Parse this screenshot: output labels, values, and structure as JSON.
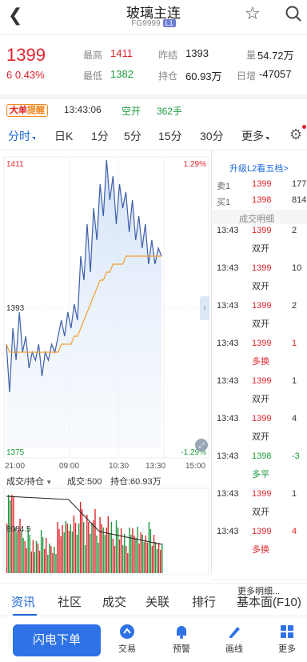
{
  "header": {
    "title": "玻璃主连",
    "code": "FG9999",
    "level_badge": "L1"
  },
  "quote": {
    "price": "1399",
    "change": "6",
    "change_pct": "0.43%",
    "high_label": "最高",
    "high": "1411",
    "low_label": "最低",
    "low": "1382",
    "prev_settle_label": "昨结",
    "prev_settle": "1393",
    "oi_label": "持仓",
    "oi": "60.93万",
    "vol_label": "量",
    "vol": "54.72万",
    "daily_inc_label": "日增",
    "daily_inc": "-47057"
  },
  "alert": {
    "badge_a": "大单",
    "badge_b": "提醒",
    "time": "13:43:06",
    "type": "空开",
    "qty": "362手"
  },
  "tabs": {
    "items": [
      "分时",
      "日K",
      "1分",
      "5分",
      "15分",
      "30分",
      "更多"
    ]
  },
  "chart": {
    "price_top": "1411",
    "price_mid": "1393",
    "price_bot": "1375",
    "pct_top": "1.29%",
    "pct_bot": "-1.29%",
    "times": [
      "21:00",
      "09:00",
      "10:30",
      "13:30",
      "15:00"
    ],
    "vol_selector": "成交/持仓",
    "vol_info": "成交:500",
    "oi_info": "持仓:60.93万",
    "vol_axis": "8084.5"
  },
  "chart_data": {
    "type": "line",
    "title": "",
    "ylim": [
      1375,
      1411
    ],
    "x_ticks": [
      "21:00",
      "09:00",
      "10:30",
      "13:30",
      "15:00"
    ],
    "series": [
      {
        "values": [
          1388,
          1382,
          1390,
          1386,
          1392,
          1387,
          1389,
          1385,
          1387,
          1386,
          1388,
          1384,
          1387,
          1386,
          1388,
          1387,
          1389,
          1391,
          1389,
          1392,
          1390,
          1393,
          1391,
          1399,
          1396,
          1403,
          1397,
          1405,
          1401,
          1408,
          1404,
          1411,
          1406,
          1409,
          1403,
          1408,
          1405,
          1407,
          1402,
          1406,
          1401,
          1404,
          1400,
          1403,
          1398,
          1401,
          1398,
          1400,
          1399
        ]
      },
      {
        "values": [
          1388,
          1387,
          1387,
          1387,
          1387,
          1387,
          1387,
          1387,
          1387,
          1387,
          1387,
          1387,
          1387,
          1387,
          1387,
          1387,
          1387,
          1388,
          1388,
          1388,
          1388,
          1389,
          1389,
          1390,
          1391,
          1392,
          1393,
          1394,
          1395,
          1396,
          1396,
          1397,
          1397,
          1398,
          1398,
          1398,
          1398,
          1399,
          1399,
          1399,
          1399,
          1399,
          1399,
          1399,
          1399,
          1399,
          1399,
          1399,
          1399
        ]
      }
    ]
  },
  "orderbook": {
    "upgrade_link": "升级L2看五档>",
    "ask_label": "卖1",
    "ask_price": "1399",
    "ask_qty": "177",
    "bid_label": "买1",
    "bid_price": "1398",
    "bid_qty": "814",
    "ticks_title": "成交明细",
    "ticks": [
      {
        "time": "13:43",
        "price": "1399",
        "type": "双开",
        "qty": "2"
      },
      {
        "time": "13:43",
        "price": "1399",
        "type": "双开",
        "qty": "10"
      },
      {
        "time": "13:43",
        "price": "1399",
        "type": "双开",
        "qty": "2"
      },
      {
        "time": "13:43",
        "price": "1399",
        "type": "多换",
        "qty": "1"
      },
      {
        "time": "13:43",
        "price": "1399",
        "type": "双开",
        "qty": "1"
      },
      {
        "time": "13:43",
        "price": "1399",
        "type": "双开",
        "qty": "4"
      },
      {
        "time": "13:43",
        "price": "1398",
        "type": "多平",
        "qty": "-3"
      },
      {
        "time": "13:43",
        "price": "1399",
        "type": "双开",
        "qty": "1"
      },
      {
        "time": "13:43",
        "price": "1399",
        "type": "多换",
        "qty": "4"
      }
    ],
    "more": "更多明细..."
  },
  "bottom_tabs": [
    "资讯",
    "社区",
    "成交",
    "关联",
    "排行",
    "基本面(F10)"
  ],
  "actions": {
    "flash": "闪电下单",
    "items": [
      "交易",
      "预警",
      "画线",
      "更多"
    ]
  },
  "colors": {
    "up": "#e0242c",
    "down": "#1b9a3c",
    "accent": "#1e68d9"
  }
}
